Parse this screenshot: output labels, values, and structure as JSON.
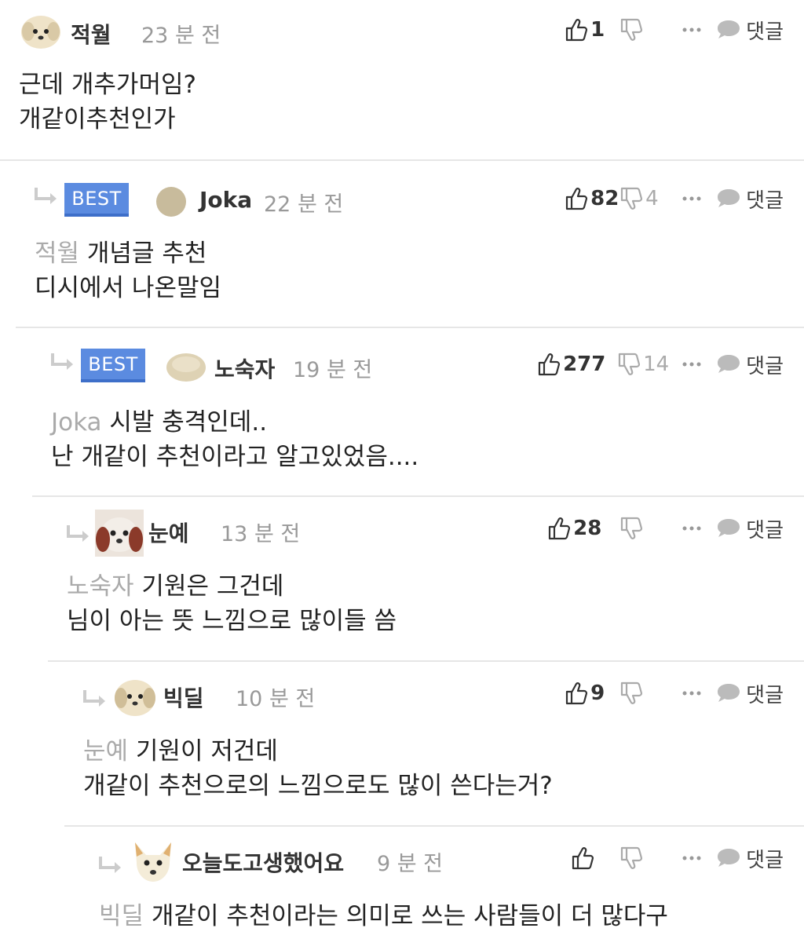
{
  "comments": [
    {
      "best": false,
      "nickname": "적월",
      "time": "23 분 전",
      "likes": "1",
      "dislikes": "",
      "reply_label": "댓글",
      "mention": "",
      "lines": [
        "근데 개추가머임?",
        "개같이추천인가"
      ]
    },
    {
      "best": true,
      "badge": "BEST",
      "nickname": "Joka",
      "time": "22 분 전",
      "likes": "82",
      "dislikes": "4",
      "reply_label": "댓글",
      "mention": "적월",
      "lines": [
        "개념글 추천",
        "디시에서 나온말임"
      ]
    },
    {
      "best": true,
      "badge": "BEST",
      "nickname": "노숙자",
      "time": "19 분 전",
      "likes": "277",
      "dislikes": "14",
      "reply_label": "댓글",
      "mention": "Joka",
      "lines": [
        "시발 충격인데..",
        "난 개같이 추천이라고 알고있었음...."
      ]
    },
    {
      "best": false,
      "nickname": "눈예",
      "time": "13 분 전",
      "likes": "28",
      "dislikes": "",
      "reply_label": "댓글",
      "mention": "노숙자",
      "lines": [
        "기원은 그건데",
        "님이 아는 뜻 느낌으로 많이들 씀"
      ]
    },
    {
      "best": false,
      "nickname": "빅딜",
      "time": "10 분 전",
      "likes": "9",
      "dislikes": "",
      "reply_label": "댓글",
      "mention": "눈예",
      "lines": [
        "기원이 저건데",
        "개같이 추천으로의 느낌으로도 많이 쓴다는거?"
      ]
    },
    {
      "best": false,
      "nickname": "오늘도고생했어요",
      "time": "9 분 전",
      "likes": "",
      "dislikes": "",
      "reply_label": "댓글",
      "mention": "빅딜",
      "lines": [
        "개같이 추천이라는 의미로 쓰는 사람들이 더 많다구"
      ]
    }
  ]
}
